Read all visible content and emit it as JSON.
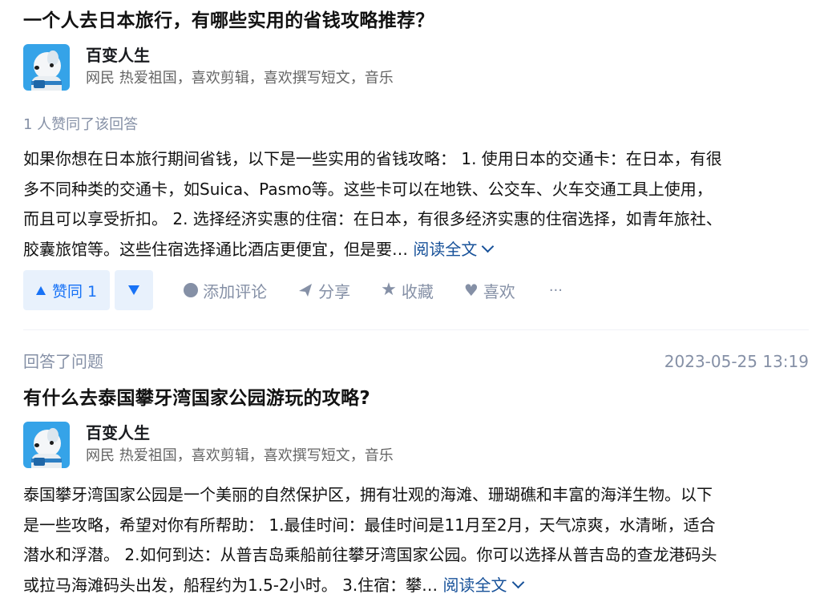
{
  "item1": {
    "question_title": "一个人去日本旅行，有哪些实用的省钱攻略推荐？",
    "author_name": "百变人生",
    "author_headline": "网民 热爱祖国，喜欢剪辑，喜欢撰写短文，音乐",
    "voters_text": "1 人赞同了该回答",
    "content_lines": [
      "如果你想在日本旅行期间省钱，以下是一些实用的省钱攻略： 1. 使用日本的交通卡：在日本，有很",
      "多不同种类的交通卡，如Suica、Pasmo等。这些卡可以在地铁、公交车、火车交通工具上使用，",
      "而且可以享受折扣。 2. 选择经济实惠的住宿：在日本，有很多经济实惠的住宿选择，如青年旅社、",
      "胶囊旅馆等。这些住宿选择通比酒店更便宜，但是要…"
    ],
    "read_more": "阅读全文",
    "actions": {
      "upvote": "赞同 1",
      "comment": "添加评论",
      "share": "分享",
      "collect": "收藏",
      "like": "喜欢",
      "more": "···"
    }
  },
  "item2": {
    "action_label": "回答了问题",
    "timestamp": "2023-05-25 13:19",
    "question_title": "有什么去泰国攀牙湾国家公园游玩的攻略?",
    "author_name": "百变人生",
    "author_headline": "网民 热爱祖国，喜欢剪辑，喜欢撰写短文，音乐",
    "content_lines": [
      "泰国攀牙湾国家公园是一个美丽的自然保护区，拥有壮观的海滩、珊瑚礁和丰富的海洋生物。以下",
      "是一些攻略，希望对你有所帮助： 1.最佳时间：最佳时间是11月至2月，天气凉爽，水清晰，适合",
      "潜水和浮潜。 2.如何到达：从普吉岛乘船前往攀牙湾国家公园。你可以选择从普吉岛的查龙港码头",
      "或拉马海滩码头出发，船程约为1.5-2小时。 3.住宿：攀…"
    ],
    "read_more": "阅读全文"
  },
  "colors": {
    "accent": "#1772f6",
    "link": "#175199",
    "muted": "#8590a6",
    "avatar_bg": "#35a3e8"
  },
  "icons": [
    "avatar",
    "triangle-up-icon",
    "triangle-down-icon",
    "comment-icon",
    "share-icon",
    "star-icon",
    "heart-icon",
    "chevron-down-icon"
  ]
}
